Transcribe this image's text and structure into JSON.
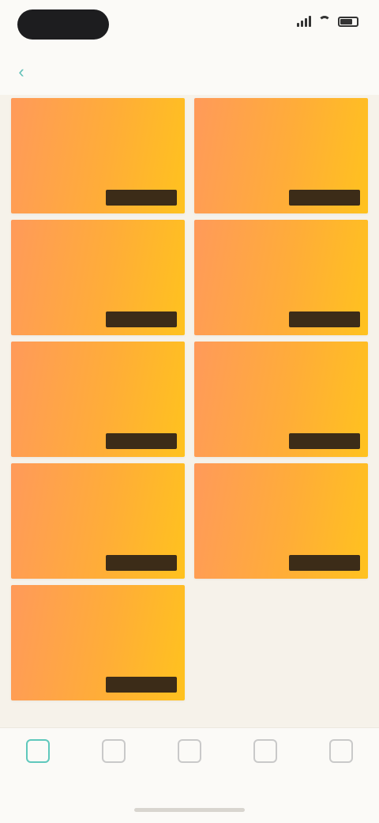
{
  "status_bar": {
    "time": "",
    "icons": [
      "signal-icon",
      "wifi-icon",
      "battery-icon"
    ]
  },
  "nav": {
    "back_icon": "chevron-left-icon",
    "title": ""
  },
  "cards": [
    {
      "title": "",
      "desc": "",
      "button": ""
    },
    {
      "title": "",
      "desc": "",
      "button": ""
    },
    {
      "title": "",
      "desc": "",
      "button": ""
    },
    {
      "title": "",
      "desc": "",
      "button": ""
    },
    {
      "title": "",
      "desc": "",
      "button": ""
    },
    {
      "title": "",
      "desc": "",
      "button": ""
    },
    {
      "title": "",
      "desc": "",
      "button": ""
    },
    {
      "title": "",
      "desc": "",
      "button": ""
    },
    {
      "title": "",
      "desc": "",
      "button": ""
    }
  ],
  "tabs": [
    {
      "icon": "home-icon",
      "label": "",
      "active": true
    },
    {
      "icon": "list-icon",
      "label": "",
      "active": false
    },
    {
      "icon": "plus-icon",
      "label": "",
      "active": false
    },
    {
      "icon": "message-icon",
      "label": "",
      "active": false
    },
    {
      "icon": "user-icon",
      "label": "",
      "active": false
    }
  ],
  "colors": {
    "accent": "#5fc8bc",
    "card_gradient_start": "#ff9a5a",
    "card_gradient_end": "#ffc21e",
    "card_button_bg": "#3c2c18",
    "background": "#f6f2ea"
  }
}
